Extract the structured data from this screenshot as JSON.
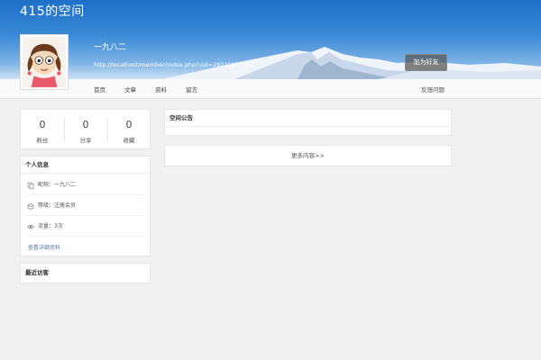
{
  "header": {
    "space_title": "415的空间",
    "user_name": "一九八二",
    "profile_url": "http://localhost/member/index.php?uid=2922121266",
    "follow_label": "加为好友"
  },
  "nav": {
    "items": [
      {
        "label": "首页"
      },
      {
        "label": "文章"
      },
      {
        "label": "资料"
      },
      {
        "label": "留言"
      }
    ],
    "feedback_label": "反馈问题"
  },
  "stats": [
    {
      "value": "0",
      "label": "粉丝"
    },
    {
      "value": "0",
      "label": "分享"
    },
    {
      "value": "0",
      "label": "收藏"
    }
  ],
  "info": {
    "title": "个人信息",
    "rows": [
      {
        "icon": "user-icon",
        "text": "昵称：一九八二"
      },
      {
        "icon": "level-icon",
        "text": "等级：注册会员"
      },
      {
        "icon": "eye-icon",
        "text": "流量：3次"
      }
    ],
    "detail_link": "查看详细资料"
  },
  "visitors": {
    "title": "最近访客"
  },
  "notice": {
    "title": "空间公告"
  },
  "more": {
    "label": "更多内容>>"
  },
  "colors": {
    "banner_top": "#1d6fc8",
    "page_bg": "#f1f1f1",
    "link": "#5a7aa0"
  }
}
